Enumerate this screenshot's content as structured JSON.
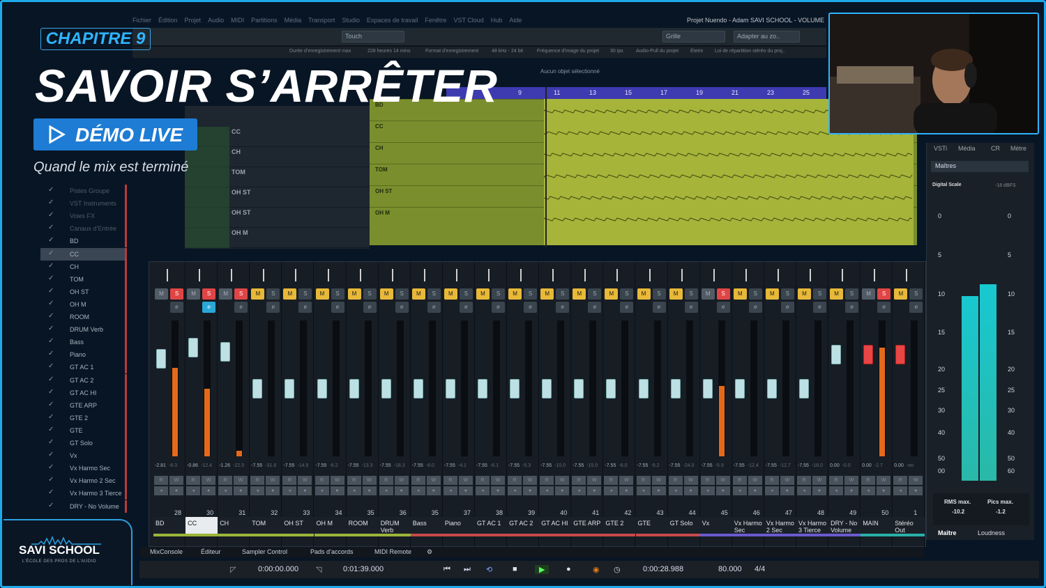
{
  "overlay": {
    "chapter": "CHAPITRE 9",
    "title": "SAVOIR S’ARRÊTER",
    "demo_label": "DÉMO LIVE",
    "subtitle": "Quand le mix est terminé"
  },
  "logo": {
    "name": "SAVI SCHOOL",
    "tagline": "L’ÉCOLE DES PROS DE L’AUDIO"
  },
  "menu": {
    "items": [
      "Fichier",
      "Édition",
      "Projet",
      "Audio",
      "MIDI",
      "Partitions",
      "Média",
      "Transport",
      "Studio",
      "Espaces de travail",
      "Fenêtre",
      "VST Cloud",
      "Hub",
      "Aide"
    ],
    "project_title": "Projet Nuendo - Adam SAVI SCHOOL - VOLUME"
  },
  "toolbar": {
    "touch": "Touch",
    "grid": "Grille",
    "adapt": "Adapter au zo.."
  },
  "infoline": {
    "items": [
      "Durée d’enregistrement max",
      "228 heures 14 mins",
      "Format d’enregistrement",
      "48 kHz - 24 bit",
      "Fréquence d’image du projet",
      "30 ips",
      "Audio-Pull du projet",
      "Éteint",
      "Loi de répartition stéréo du proj.."
    ]
  },
  "arrange": {
    "no_selection": "Aucun objet sélectionné",
    "ruler": [
      "7",
      "9",
      "11",
      "13",
      "15",
      "17",
      "19",
      "21",
      "23",
      "25"
    ],
    "lanes": [
      "BD",
      "CC",
      "CH",
      "TOM",
      "OH ST",
      "OH M"
    ]
  },
  "track_headers": [
    {
      "name": "CC"
    },
    {
      "name": "CH"
    },
    {
      "name": "TOM"
    },
    {
      "name": "OH ST"
    },
    {
      "name": "OH ST"
    },
    {
      "name": "OH M"
    }
  ],
  "tracklist": {
    "items": [
      "Pistes Groupe",
      "VST Instruments",
      "Voies FX",
      "Canaux d’Entrée",
      "BD",
      "CC",
      "CH",
      "TOM",
      "OH ST",
      "OH M",
      "ROOM",
      "DRUM Verb",
      "Bass",
      "Piano",
      "GT AC 1",
      "GT AC 2",
      "GT AC HI",
      "GTE ARP",
      "GTE 2",
      "GTE",
      "GT Solo",
      "Vx",
      "Vx Harmo Sec",
      "Vx Harmo 2 Sec",
      "Vx Harmo 3 Tierce",
      "DRY - No Volume"
    ],
    "selected": "CC"
  },
  "mixer": {
    "channels": [
      {
        "num": "28",
        "name": "BD",
        "v1": "-2.81",
        "v2": "-8.3",
        "mute": false,
        "solo": true,
        "fader": 0.72,
        "meter": 0.65,
        "color": "#9bb53a"
      },
      {
        "num": "30",
        "name": "CC",
        "v1": "-0.86",
        "v2": "-12.4",
        "mute": false,
        "solo": true,
        "fader": 0.8,
        "meter": 0.5,
        "color": "#9bb53a"
      },
      {
        "num": "31",
        "name": "CH",
        "v1": "-1.26",
        "v2": "-22.5",
        "mute": false,
        "solo": true,
        "fader": 0.77,
        "meter": 0.04,
        "color": "#9bb53a"
      },
      {
        "num": "32",
        "name": "TOM",
        "v1": "-7.55",
        "v2": "-31.6",
        "mute": true,
        "solo": false,
        "fader": 0.5,
        "meter": 0,
        "color": "#9bb53a"
      },
      {
        "num": "33",
        "name": "OH ST",
        "v1": "-7.55",
        "v2": "-14.9",
        "mute": true,
        "solo": false,
        "fader": 0.5,
        "meter": 0,
        "color": "#9bb53a"
      },
      {
        "num": "34",
        "name": "OH M",
        "v1": "-7.55",
        "v2": "-8.2",
        "mute": true,
        "solo": false,
        "fader": 0.5,
        "meter": 0,
        "color": "#9bb53a"
      },
      {
        "num": "35",
        "name": "ROOM",
        "v1": "-7.55",
        "v2": "-13.3",
        "mute": true,
        "solo": false,
        "fader": 0.5,
        "meter": 0,
        "color": "#9bb53a"
      },
      {
        "num": "36",
        "name": "DRUM Verb",
        "v1": "-7.55",
        "v2": "-18.3",
        "mute": true,
        "solo": false,
        "fader": 0.5,
        "meter": 0,
        "color": "#9bb53a"
      },
      {
        "num": "35",
        "name": "Bass",
        "v1": "-7.55",
        "v2": "-8.0",
        "mute": true,
        "solo": false,
        "fader": 0.5,
        "meter": 0,
        "color": "#c84a4a"
      },
      {
        "num": "37",
        "name": "Piano",
        "v1": "-7.55",
        "v2": "-4.1",
        "mute": true,
        "solo": false,
        "fader": 0.5,
        "meter": 0,
        "color": "#c84a4a"
      },
      {
        "num": "38",
        "name": "GT AC 1",
        "v1": "-7.55",
        "v2": "-6.1",
        "mute": true,
        "solo": false,
        "fader": 0.5,
        "meter": 0,
        "color": "#c84a4a"
      },
      {
        "num": "39",
        "name": "GT AC 2",
        "v1": "-7.55",
        "v2": "-5.3",
        "mute": true,
        "solo": false,
        "fader": 0.5,
        "meter": 0,
        "color": "#c84a4a"
      },
      {
        "num": "40",
        "name": "GT AC HI",
        "v1": "-7.55",
        "v2": "-10.0",
        "mute": true,
        "solo": false,
        "fader": 0.5,
        "meter": 0,
        "color": "#c84a4a"
      },
      {
        "num": "41",
        "name": "GTE ARP",
        "v1": "-7.55",
        "v2": "-15.0",
        "mute": true,
        "solo": false,
        "fader": 0.5,
        "meter": 0,
        "color": "#c84a4a"
      },
      {
        "num": "42",
        "name": "GTE 2",
        "v1": "-7.55",
        "v2": "-8.0",
        "mute": true,
        "solo": false,
        "fader": 0.5,
        "meter": 0,
        "color": "#c84a4a"
      },
      {
        "num": "43",
        "name": "GTE",
        "v1": "-7.55",
        "v2": "-9.2",
        "mute": true,
        "solo": false,
        "fader": 0.5,
        "meter": 0,
        "color": "#c84a4a"
      },
      {
        "num": "44",
        "name": "GT Solo",
        "v1": "-7.55",
        "v2": "-24.0",
        "mute": true,
        "solo": false,
        "fader": 0.5,
        "meter": 0,
        "color": "#c84a4a"
      },
      {
        "num": "45",
        "name": "Vx",
        "v1": "-7.55",
        "v2": "-5.9",
        "mute": false,
        "solo": true,
        "fader": 0.5,
        "meter": 0.52,
        "color": "#6a5acd"
      },
      {
        "num": "46",
        "name": "Vx Harmo Sec",
        "v1": "-7.55",
        "v2": "-12.4",
        "mute": true,
        "solo": false,
        "fader": 0.5,
        "meter": 0,
        "color": "#6a5acd"
      },
      {
        "num": "47",
        "name": "Vx Harmo 2 Sec",
        "v1": "-7.55",
        "v2": "-12.7",
        "mute": true,
        "solo": false,
        "fader": 0.5,
        "meter": 0,
        "color": "#6a5acd"
      },
      {
        "num": "48",
        "name": "Vx Harmo 3 Tierce",
        "v1": "-7.55",
        "v2": "-18.0",
        "mute": true,
        "solo": false,
        "fader": 0.5,
        "meter": 0,
        "color": "#6a5acd"
      },
      {
        "num": "49",
        "name": "DRY - No Volume",
        "v1": "0.00",
        "v2": "-0.0",
        "mute": true,
        "solo": false,
        "fader": 0.75,
        "meter": 0,
        "color": "#6a5acd"
      },
      {
        "num": "50",
        "name": "MAIN",
        "v1": "0.00",
        "v2": "-2.7",
        "mute": false,
        "solo": true,
        "fader": 0.75,
        "meter": 0.8,
        "color": "#2ab0a8"
      },
      {
        "num": "1",
        "name": "Stéréo Out",
        "v1": "0.00",
        "v2": "-oo",
        "mute": true,
        "solo": false,
        "fader": 0.75,
        "meter": 0,
        "color": "#2ab0a8"
      }
    ]
  },
  "right_panel": {
    "tabs": [
      "VSTi",
      "Média",
      "CR",
      "Mètre"
    ],
    "section": "Maîtres",
    "digital_scale": "Digital Scale",
    "dbfs": "-18 dBFS",
    "scale": [
      "0",
      "5",
      "10",
      "15",
      "20",
      "25",
      "30",
      "40",
      "50",
      "00"
    ],
    "scale_right": [
      "0",
      "5",
      "10",
      "15",
      "20",
      "25",
      "30",
      "40",
      "50",
      "60"
    ],
    "rms_label": "RMS max.",
    "rms_value": "-10.2",
    "peak_label": "Pics max.",
    "peak_value": "-1.2",
    "tab_master": "Maître",
    "tab_loudness": "Loudness",
    "levels": [
      0.72,
      0.76
    ]
  },
  "bottom_tabs": [
    "MixConsole",
    "Éditeur",
    "Sampler Control",
    "Pads d’accords",
    "MIDI Remote"
  ],
  "transport": {
    "left_locator": "0:00:00.000",
    "right_locator": "0:01:39.000",
    "position": "0:00:28.988",
    "tempo": "80.000",
    "signature": "4/4"
  }
}
